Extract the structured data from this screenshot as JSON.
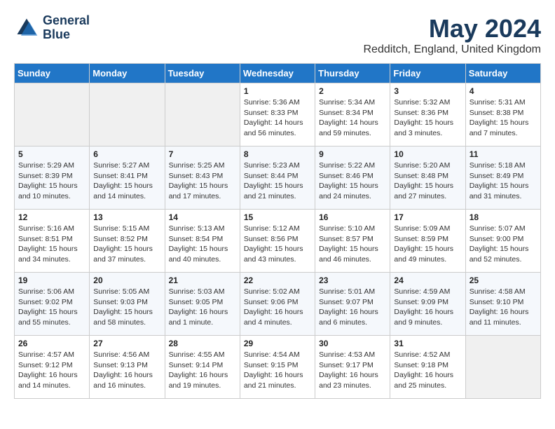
{
  "header": {
    "logo_line1": "General",
    "logo_line2": "Blue",
    "month_year": "May 2024",
    "location": "Redditch, England, United Kingdom"
  },
  "days_of_week": [
    "Sunday",
    "Monday",
    "Tuesday",
    "Wednesday",
    "Thursday",
    "Friday",
    "Saturday"
  ],
  "weeks": [
    [
      {
        "num": "",
        "info": ""
      },
      {
        "num": "",
        "info": ""
      },
      {
        "num": "",
        "info": ""
      },
      {
        "num": "1",
        "info": "Sunrise: 5:36 AM\nSunset: 8:33 PM\nDaylight: 14 hours\nand 56 minutes."
      },
      {
        "num": "2",
        "info": "Sunrise: 5:34 AM\nSunset: 8:34 PM\nDaylight: 14 hours\nand 59 minutes."
      },
      {
        "num": "3",
        "info": "Sunrise: 5:32 AM\nSunset: 8:36 PM\nDaylight: 15 hours\nand 3 minutes."
      },
      {
        "num": "4",
        "info": "Sunrise: 5:31 AM\nSunset: 8:38 PM\nDaylight: 15 hours\nand 7 minutes."
      }
    ],
    [
      {
        "num": "5",
        "info": "Sunrise: 5:29 AM\nSunset: 8:39 PM\nDaylight: 15 hours\nand 10 minutes."
      },
      {
        "num": "6",
        "info": "Sunrise: 5:27 AM\nSunset: 8:41 PM\nDaylight: 15 hours\nand 14 minutes."
      },
      {
        "num": "7",
        "info": "Sunrise: 5:25 AM\nSunset: 8:43 PM\nDaylight: 15 hours\nand 17 minutes."
      },
      {
        "num": "8",
        "info": "Sunrise: 5:23 AM\nSunset: 8:44 PM\nDaylight: 15 hours\nand 21 minutes."
      },
      {
        "num": "9",
        "info": "Sunrise: 5:22 AM\nSunset: 8:46 PM\nDaylight: 15 hours\nand 24 minutes."
      },
      {
        "num": "10",
        "info": "Sunrise: 5:20 AM\nSunset: 8:48 PM\nDaylight: 15 hours\nand 27 minutes."
      },
      {
        "num": "11",
        "info": "Sunrise: 5:18 AM\nSunset: 8:49 PM\nDaylight: 15 hours\nand 31 minutes."
      }
    ],
    [
      {
        "num": "12",
        "info": "Sunrise: 5:16 AM\nSunset: 8:51 PM\nDaylight: 15 hours\nand 34 minutes."
      },
      {
        "num": "13",
        "info": "Sunrise: 5:15 AM\nSunset: 8:52 PM\nDaylight: 15 hours\nand 37 minutes."
      },
      {
        "num": "14",
        "info": "Sunrise: 5:13 AM\nSunset: 8:54 PM\nDaylight: 15 hours\nand 40 minutes."
      },
      {
        "num": "15",
        "info": "Sunrise: 5:12 AM\nSunset: 8:56 PM\nDaylight: 15 hours\nand 43 minutes."
      },
      {
        "num": "16",
        "info": "Sunrise: 5:10 AM\nSunset: 8:57 PM\nDaylight: 15 hours\nand 46 minutes."
      },
      {
        "num": "17",
        "info": "Sunrise: 5:09 AM\nSunset: 8:59 PM\nDaylight: 15 hours\nand 49 minutes."
      },
      {
        "num": "18",
        "info": "Sunrise: 5:07 AM\nSunset: 9:00 PM\nDaylight: 15 hours\nand 52 minutes."
      }
    ],
    [
      {
        "num": "19",
        "info": "Sunrise: 5:06 AM\nSunset: 9:02 PM\nDaylight: 15 hours\nand 55 minutes."
      },
      {
        "num": "20",
        "info": "Sunrise: 5:05 AM\nSunset: 9:03 PM\nDaylight: 15 hours\nand 58 minutes."
      },
      {
        "num": "21",
        "info": "Sunrise: 5:03 AM\nSunset: 9:05 PM\nDaylight: 16 hours\nand 1 minute."
      },
      {
        "num": "22",
        "info": "Sunrise: 5:02 AM\nSunset: 9:06 PM\nDaylight: 16 hours\nand 4 minutes."
      },
      {
        "num": "23",
        "info": "Sunrise: 5:01 AM\nSunset: 9:07 PM\nDaylight: 16 hours\nand 6 minutes."
      },
      {
        "num": "24",
        "info": "Sunrise: 4:59 AM\nSunset: 9:09 PM\nDaylight: 16 hours\nand 9 minutes."
      },
      {
        "num": "25",
        "info": "Sunrise: 4:58 AM\nSunset: 9:10 PM\nDaylight: 16 hours\nand 11 minutes."
      }
    ],
    [
      {
        "num": "26",
        "info": "Sunrise: 4:57 AM\nSunset: 9:12 PM\nDaylight: 16 hours\nand 14 minutes."
      },
      {
        "num": "27",
        "info": "Sunrise: 4:56 AM\nSunset: 9:13 PM\nDaylight: 16 hours\nand 16 minutes."
      },
      {
        "num": "28",
        "info": "Sunrise: 4:55 AM\nSunset: 9:14 PM\nDaylight: 16 hours\nand 19 minutes."
      },
      {
        "num": "29",
        "info": "Sunrise: 4:54 AM\nSunset: 9:15 PM\nDaylight: 16 hours\nand 21 minutes."
      },
      {
        "num": "30",
        "info": "Sunrise: 4:53 AM\nSunset: 9:17 PM\nDaylight: 16 hours\nand 23 minutes."
      },
      {
        "num": "31",
        "info": "Sunrise: 4:52 AM\nSunset: 9:18 PM\nDaylight: 16 hours\nand 25 minutes."
      },
      {
        "num": "",
        "info": ""
      }
    ]
  ]
}
